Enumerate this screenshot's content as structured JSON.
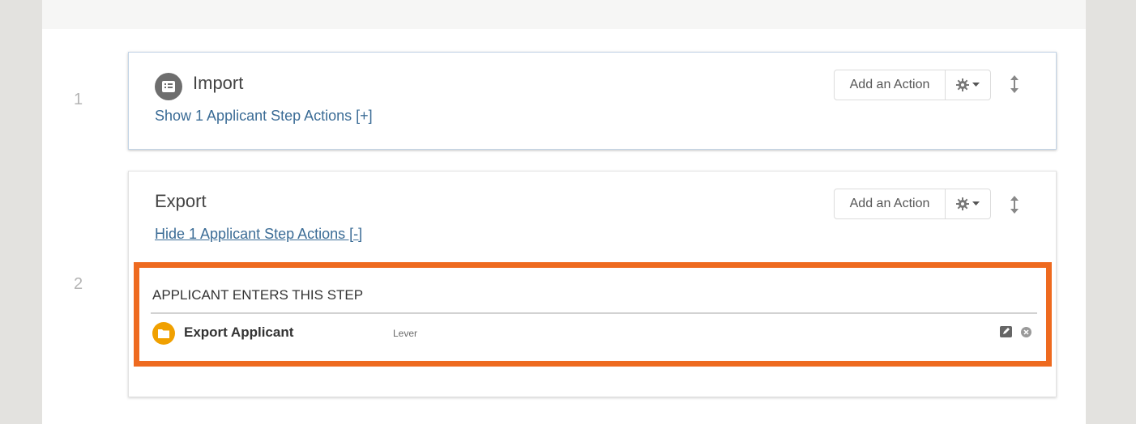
{
  "steps": [
    {
      "number": "1",
      "title": "Import",
      "toggle_label": "Show 1 Applicant Step Actions [+]",
      "add_action_label": "Add an Action"
    },
    {
      "number": "2",
      "title": "Export",
      "toggle_label": "Hide 1 Applicant Step Actions [-]",
      "add_action_label": "Add an Action",
      "section_header": "APPLICANT ENTERS THIS STEP",
      "actions": [
        {
          "name": "Export Applicant",
          "target": "Lever",
          "icon": "folder-icon"
        }
      ]
    }
  ],
  "colors": {
    "highlight": "#ee6a1f",
    "link": "#3b6c96",
    "action_icon": "#f0a000"
  }
}
